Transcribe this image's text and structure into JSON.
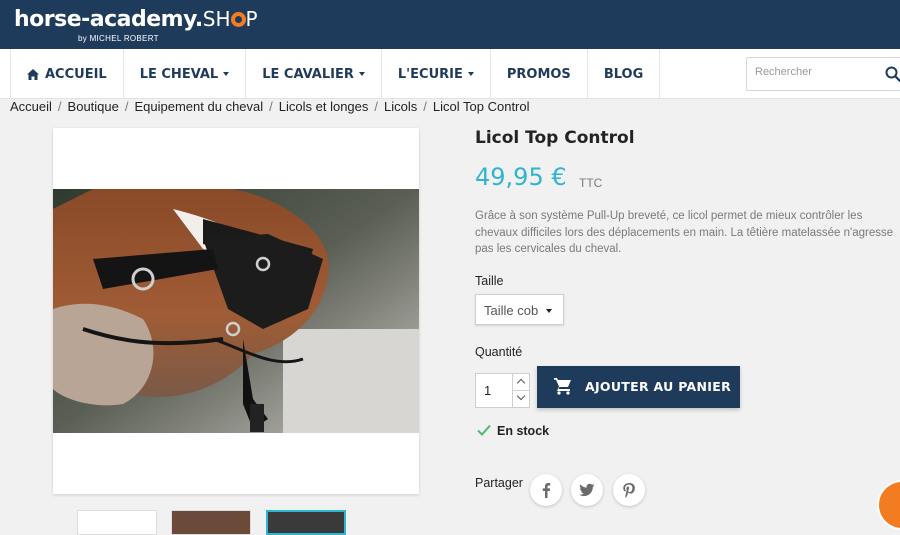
{
  "brand": {
    "name": "horse-academy.",
    "shop": "SH",
    "shop_end": "P",
    "tagline": "by MICHEL ROBERT"
  },
  "nav": {
    "home": "ACCUEIL",
    "items": [
      "LE CHEVAL",
      "LE CAVALIER",
      "L'ECURIE",
      "PROMOS",
      "BLOG"
    ]
  },
  "search": {
    "placeholder": "Rechercher"
  },
  "breadcrumb": [
    "Accueil",
    "Boutique",
    "Equipement du cheval",
    "Licols et longes",
    "Licols",
    "Licol Top Control"
  ],
  "product": {
    "title": "Licol Top Control",
    "price": "49,95 €",
    "tax_label": "TTC",
    "description": "Grâce à son système Pull-Up breveté, ce licol permet de mieux contrôler les chevaux difficiles lors des déplacements en main. La têtière matelassée n'agresse pas les cervicales du cheval.",
    "size_label": "Taille",
    "size_selected": "Taille cob",
    "quantity_label": "Quantité",
    "quantity_value": "1",
    "add_to_cart": "AJOUTER AU PANIER",
    "stock_status": "En stock",
    "share_label": "Partager"
  },
  "colors": {
    "primary": "#1f3b5c",
    "accent": "#2fb5d2",
    "orange": "#f47c20",
    "stock": "#4cbb6c"
  },
  "icons": [
    "home-icon",
    "search-icon",
    "cart-icon",
    "check-icon",
    "facebook-icon",
    "twitter-icon",
    "pinterest-icon"
  ]
}
